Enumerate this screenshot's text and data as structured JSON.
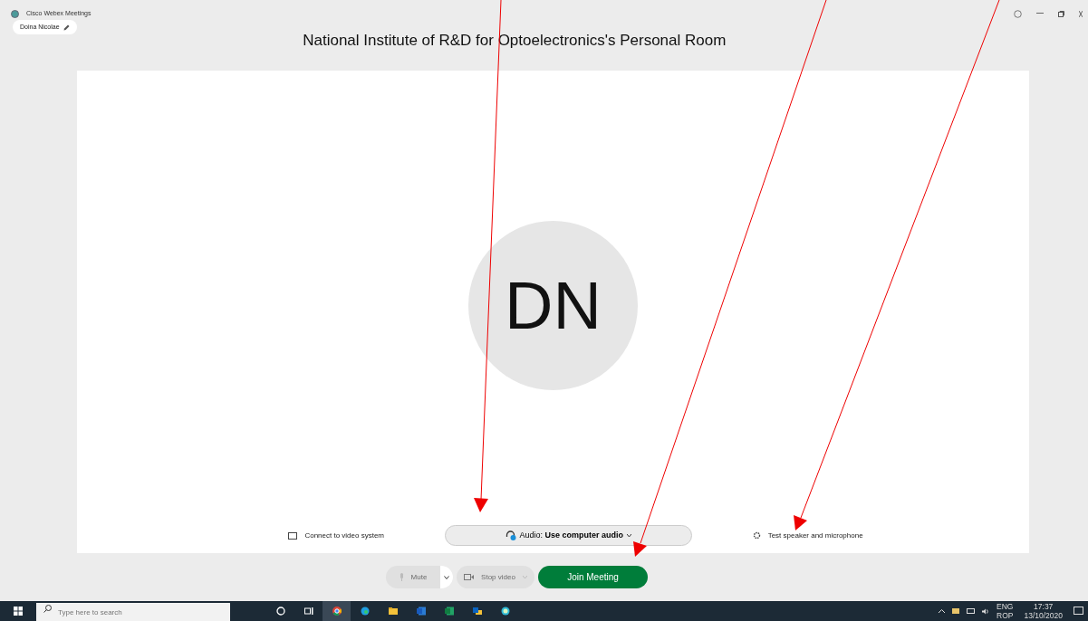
{
  "window": {
    "title": "Cisco Webex Meetings"
  },
  "user_chip": {
    "label": "Doina Nicolae"
  },
  "room_title": "National Institute of R&D for Optoelectronics's Personal Room",
  "avatar": {
    "initials": "DN"
  },
  "options": {
    "connect": "Connect to video system",
    "audio_label": "Audio:",
    "audio_value": "Use computer audio",
    "test": "Test speaker and microphone"
  },
  "controls": [
    {
      "kind": "mute",
      "label": "Mute",
      "disabled": true
    },
    {
      "kind": "video",
      "label": "Stop video",
      "disabled": true
    },
    {
      "kind": "join",
      "label": "Join Meeting",
      "disabled": false
    }
  ],
  "taskbar": {
    "search_placeholder": "Type here to search",
    "apps": [
      {
        "kind": "cortana",
        "selected": false
      },
      {
        "kind": "taskview",
        "selected": false
      },
      {
        "kind": "chrome",
        "selected": true
      },
      {
        "kind": "edge",
        "selected": false
      },
      {
        "kind": "explorer",
        "selected": false
      },
      {
        "kind": "word",
        "selected": false
      },
      {
        "kind": "excel",
        "selected": false
      },
      {
        "kind": "outlook",
        "selected": false
      },
      {
        "kind": "webex",
        "selected": false
      }
    ],
    "lang_top": "ENG",
    "lang_bottom": "ROP",
    "time": "17:37",
    "date": "13/10/2020"
  }
}
